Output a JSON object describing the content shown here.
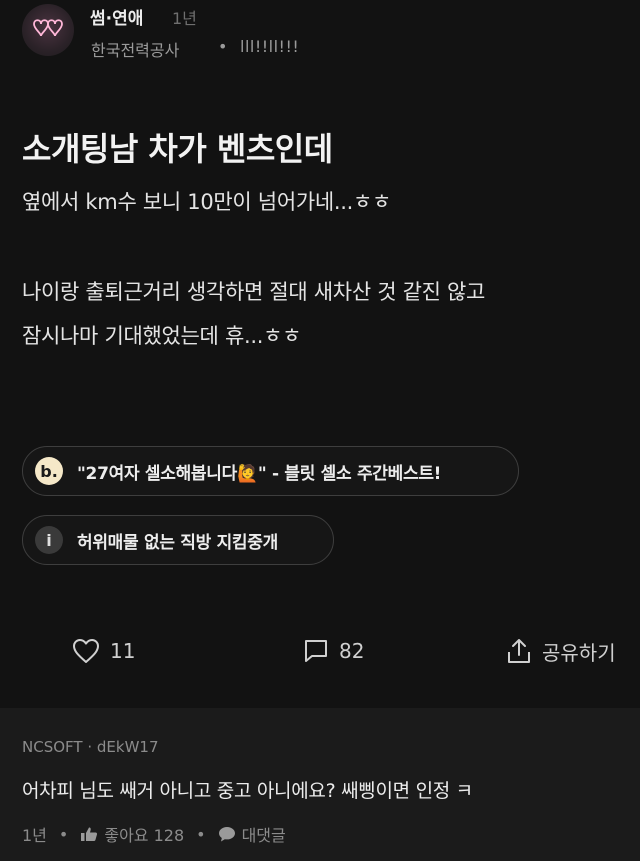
{
  "post": {
    "channel": "썸·연애",
    "time": "1년",
    "company": "한국전력공사",
    "separator": "•",
    "nickname": "lll!!ll!!!",
    "title": "소개팅남 차가 벤츠인데",
    "body_lines": [
      "옆에서 km수 보니 10만이 넘어가네...ㅎㅎ",
      "나이랑 출퇴근거리 생각하면 절대 새차산 것 같진 않고",
      "잠시나마 기대했었는데 휴...ㅎㅎ"
    ]
  },
  "links": [
    {
      "icon_text": "b.",
      "icon": "blind-logo-icon",
      "label": "\"27여자 셀소해봅니다🙋\" - 블릿 셀소 주간베스트!"
    },
    {
      "icon_text": "i",
      "icon": "info-icon",
      "label": "허위매물 없는 직방 지킴중개"
    }
  ],
  "actions": {
    "likes": "11",
    "comments": "82",
    "share_label": "공유하기"
  },
  "comment": {
    "company": "NCSOFT",
    "separator": "·",
    "nickname": "dEkW17",
    "text": "어차피 님도 쌔거 아니고 중고 아니에요? 쌔삥이면 인정 ㅋ",
    "time": "1년",
    "like_label": "좋아요 128",
    "reply_label": "대댓글"
  },
  "colors": {
    "background": "#121212",
    "comment_background": "#1b1b1b",
    "blind_badge": "#f5e8c8",
    "info_badge": "#3a3a3a"
  }
}
